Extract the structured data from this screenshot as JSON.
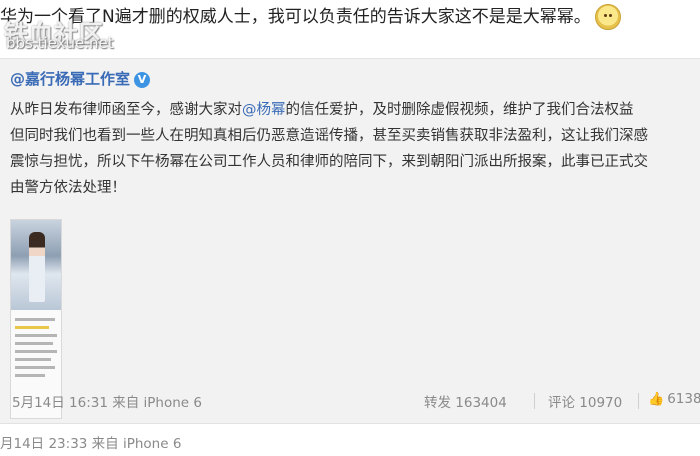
{
  "watermark": {
    "brand": "铁血社区",
    "url": "bbs.tiexue.net"
  },
  "post": {
    "text": "华为一个看了N遍才删的权威人士，我可以负责任的告诉大家这不是是大幂幂。",
    "emoji_icon": "dog-face-icon",
    "timestamp_source": "月14日 23:33 来自 iPhone 6"
  },
  "repost": {
    "author": "@嘉行杨幂工作室",
    "verified_icon": "verified-v-icon",
    "content_lines": [
      {
        "before": "从昨日发布律师函至今，感谢大家对",
        "mention": "@杨幂",
        "after": "的信任爱护，及时删除虚假视频，维护了我们合法权益"
      },
      {
        "before": "但同时我们也看到一些人在明知真相后仍恶意造谣传播，甚至买卖销售获取非法盈利，这让我们深感",
        "mention": "",
        "after": ""
      },
      {
        "before": "震惊与担忧，所以下午杨幂在公司工作人员和律师的陪同下，来到朝阳门派出所报案，此事已正式交",
        "mention": "",
        "after": ""
      },
      {
        "before": "由警方依法处理！",
        "mention": "",
        "after": ""
      }
    ],
    "meta": "5月14日 16:31 来自 iPhone 6",
    "repost_label": "转发 163404",
    "comment_label": "评论 10970",
    "like_count": "6138",
    "like_icon": "thumbs-up-icon"
  },
  "colors": {
    "link": "#3a6bb6",
    "meta": "#8a8a8a",
    "repost_bg": "#f2f2f2"
  }
}
